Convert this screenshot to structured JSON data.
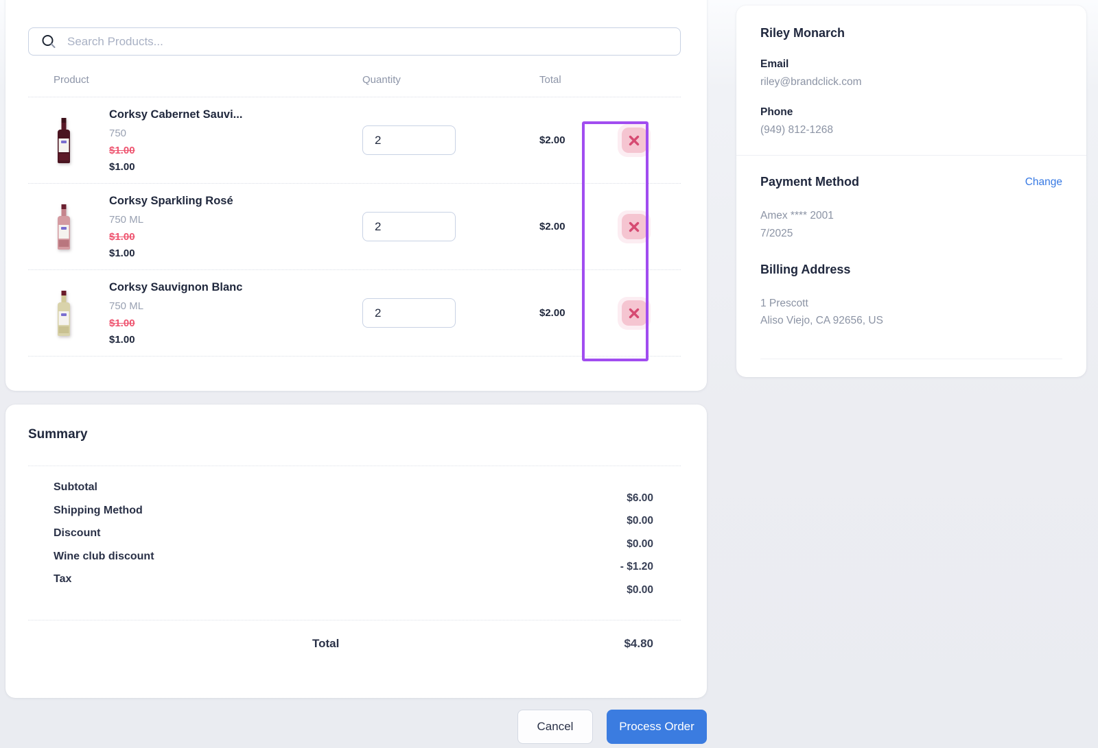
{
  "search": {
    "placeholder": "Search Products..."
  },
  "table": {
    "headers": {
      "product": "Product",
      "quantity": "Quantity",
      "total": "Total"
    }
  },
  "products": [
    {
      "title": "Corksy Cabernet Sauvi...",
      "size": "750",
      "old_price": "$1.00",
      "price": "$1.00",
      "quantity": "2",
      "total": "$2.00"
    },
    {
      "title": "Corksy Sparkling Rosé",
      "size": "750 ML",
      "old_price": "$1.00",
      "price": "$1.00",
      "quantity": "2",
      "total": "$2.00"
    },
    {
      "title": "Corksy Sauvignon Blanc",
      "size": "750 ML",
      "old_price": "$1.00",
      "price": "$1.00",
      "quantity": "2",
      "total": "$2.00"
    }
  ],
  "summary": {
    "title": "Summary",
    "rows": [
      {
        "label": "Subtotal",
        "value": "$6.00"
      },
      {
        "label": "Shipping Method",
        "value": "$0.00"
      },
      {
        "label": "Discount",
        "value": "$0.00"
      },
      {
        "label": "Wine club discount",
        "value": "- $1.20"
      },
      {
        "label": "Tax",
        "value": "$0.00"
      }
    ],
    "total_label": "Total",
    "total_value": "$4.80"
  },
  "customer": {
    "name": "Riley Monarch",
    "email_label": "Email",
    "email": "riley@brandclick.com",
    "phone_label": "Phone",
    "phone": "(949) 812-1268"
  },
  "payment": {
    "title": "Payment Method",
    "change_label": "Change",
    "card": "Amex **** 2001",
    "expiry": "7/2025",
    "billing_title": "Billing Address",
    "address_line1": "1 Prescott",
    "address_line2": "Aliso Viejo, CA 92656, US"
  },
  "actions": {
    "cancel": "Cancel",
    "process": "Process Order"
  },
  "colors": {
    "accent_blue": "#3b7ce0",
    "link_blue": "#3779e3",
    "danger_x": "#d64a72",
    "danger_bg": "#f5c5d1",
    "highlight_purple": "#a14df0",
    "strike_red": "#ee5570"
  }
}
